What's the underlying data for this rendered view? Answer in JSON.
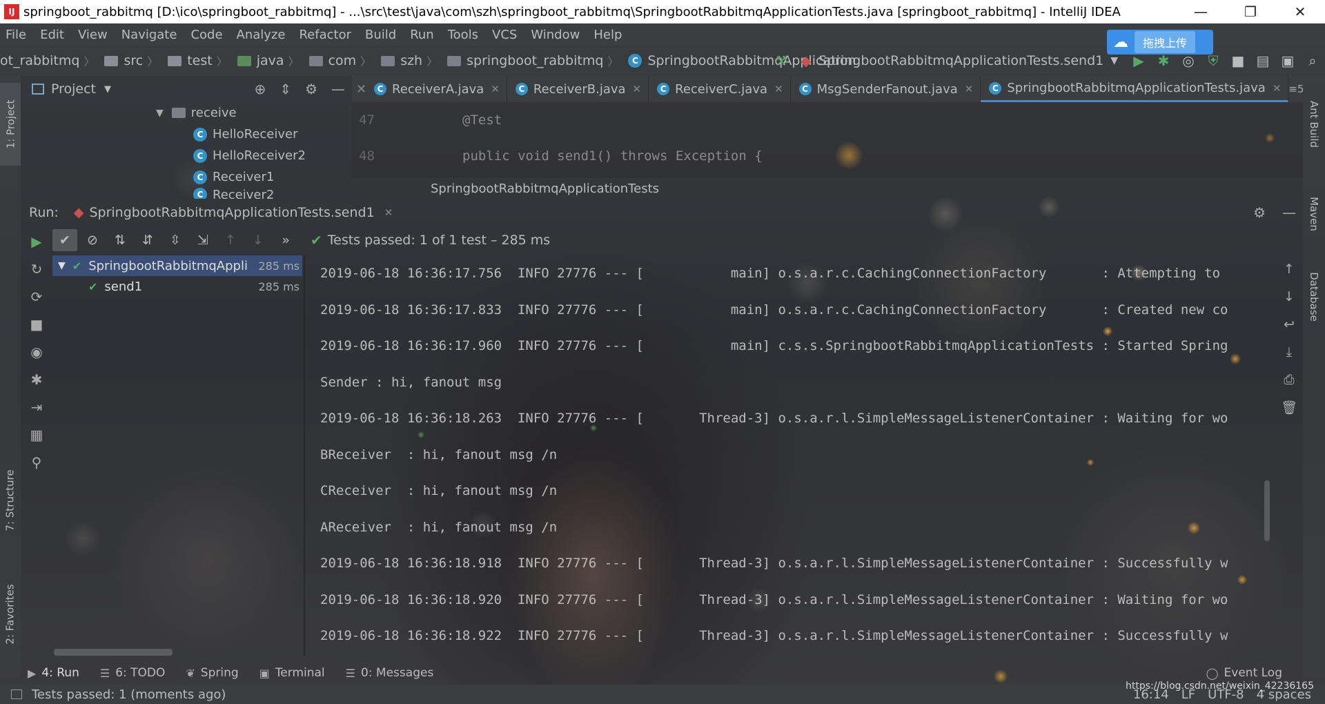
{
  "window": {
    "title": "springboot_rabbitmq [D:\\ico\\springboot_rabbitmq] - ...\\src\\test\\java\\com\\szh\\springboot_rabbitmq\\SpringbootRabbitmqApplicationTests.java [springboot_rabbitmq] - IntelliJ IDEA",
    "app_icon": "IJ",
    "minimize_icon": "—",
    "restore_icon": "❐",
    "close_icon": "✕"
  },
  "menu": [
    "File",
    "Edit",
    "View",
    "Navigate",
    "Code",
    "Analyze",
    "Refactor",
    "Build",
    "Run",
    "Tools",
    "VCS",
    "Window",
    "Help"
  ],
  "upload_badge": {
    "label": "拖拽上传"
  },
  "breadcrumbs": [
    "ot_rabbitmq",
    "src",
    "test",
    "java",
    "com",
    "szh",
    "springboot_rabbitmq",
    "SpringbootRabbitmqApplication"
  ],
  "run_config": {
    "label": "SpringbootRabbitmqApplicationTests.send1"
  },
  "left_stripe": {
    "project": "1: Project",
    "structure": "7: Structure",
    "favorites": "2: Favorites"
  },
  "right_stripe": {
    "ant": "Ant Build",
    "maven": "Maven",
    "database": "Database"
  },
  "project_panel": {
    "title": "Project",
    "tree": [
      {
        "label": "receive",
        "type": "folder",
        "indent": 1
      },
      {
        "label": "HelloReceiver",
        "type": "class",
        "indent": 2
      },
      {
        "label": "HelloReceiver2",
        "type": "class",
        "indent": 2
      },
      {
        "label": "Receiver1",
        "type": "class",
        "indent": 2
      },
      {
        "label": "Receiver2",
        "type": "class",
        "indent": 2
      }
    ]
  },
  "editor": {
    "tabs": [
      {
        "label": "ReceiverA.java",
        "active": false
      },
      {
        "label": "ReceiverB.java",
        "active": false
      },
      {
        "label": "ReceiverC.java",
        "active": false
      },
      {
        "label": "MsgSenderFanout.java",
        "active": false
      },
      {
        "label": "SpringbootRabbitmqApplicationTests.java",
        "active": true
      }
    ],
    "tab_overflow": "≡5",
    "lines": [
      {
        "num": "47",
        "text": "@Test"
      },
      {
        "num": "48",
        "text": "public void send1() throws Exception {"
      }
    ],
    "breadcrumb": "SpringbootRabbitmqApplicationTests"
  },
  "run": {
    "label": "Run:",
    "config": "SpringbootRabbitmqApplicationTests.send1",
    "status_text": "Tests passed: 1 of 1 test – 285 ms",
    "tree": [
      {
        "label": "SpringbootRabbitmqAppli",
        "duration": "285 ms",
        "selected": true
      },
      {
        "label": "send1",
        "duration": "285 ms",
        "selected": false
      }
    ],
    "console": [
      "2019-06-18 16:36:17.756  INFO 27776 --- [           main] o.s.a.r.c.CachingConnectionFactory       : Attempting to",
      "2019-06-18 16:36:17.833  INFO 27776 --- [           main] o.s.a.r.c.CachingConnectionFactory       : Created new co",
      "2019-06-18 16:36:17.960  INFO 27776 --- [           main] c.s.s.SpringbootRabbitmqApplicationTests : Started Spring",
      "Sender : hi, fanout msg",
      "2019-06-18 16:36:18.263  INFO 27776 --- [       Thread-3] o.s.a.r.l.SimpleMessageListenerContainer : Waiting for wo",
      "BReceiver  : hi, fanout msg /n",
      "CReceiver  : hi, fanout msg /n",
      "AReceiver  : hi, fanout msg /n",
      "2019-06-18 16:36:18.918  INFO 27776 --- [       Thread-3] o.s.a.r.l.SimpleMessageListenerContainer : Successfully w",
      "2019-06-18 16:36:18.920  INFO 27776 --- [       Thread-3] o.s.a.r.l.SimpleMessageListenerContainer : Waiting for wo",
      "2019-06-18 16:36:18.922  INFO 27776 --- [       Thread-3] o.s.a.r.l.SimpleMessageListenerContainer : Successfully w"
    ]
  },
  "bottom_tabs": [
    {
      "label": "4: Run",
      "icon": "▶",
      "active": true
    },
    {
      "label": "6: TODO",
      "icon": "☰",
      "active": false
    },
    {
      "label": "Spring",
      "icon": "❦",
      "active": false
    },
    {
      "label": "Terminal",
      "icon": "▣",
      "active": false
    },
    {
      "label": "0: Messages",
      "icon": "☰",
      "active": false
    }
  ],
  "event_log": "Event Log",
  "status": {
    "message": "Tests passed: 1 (moments ago)",
    "position": "16:14",
    "line_sep": "LF",
    "encoding": "UTF-8",
    "indent": "4 spaces",
    "watermark": "https://blog.csdn.net/weixin_42236165"
  },
  "colors": {
    "accent": "#4a88c7",
    "pass": "#59a869",
    "panel": "#3c3f41"
  }
}
